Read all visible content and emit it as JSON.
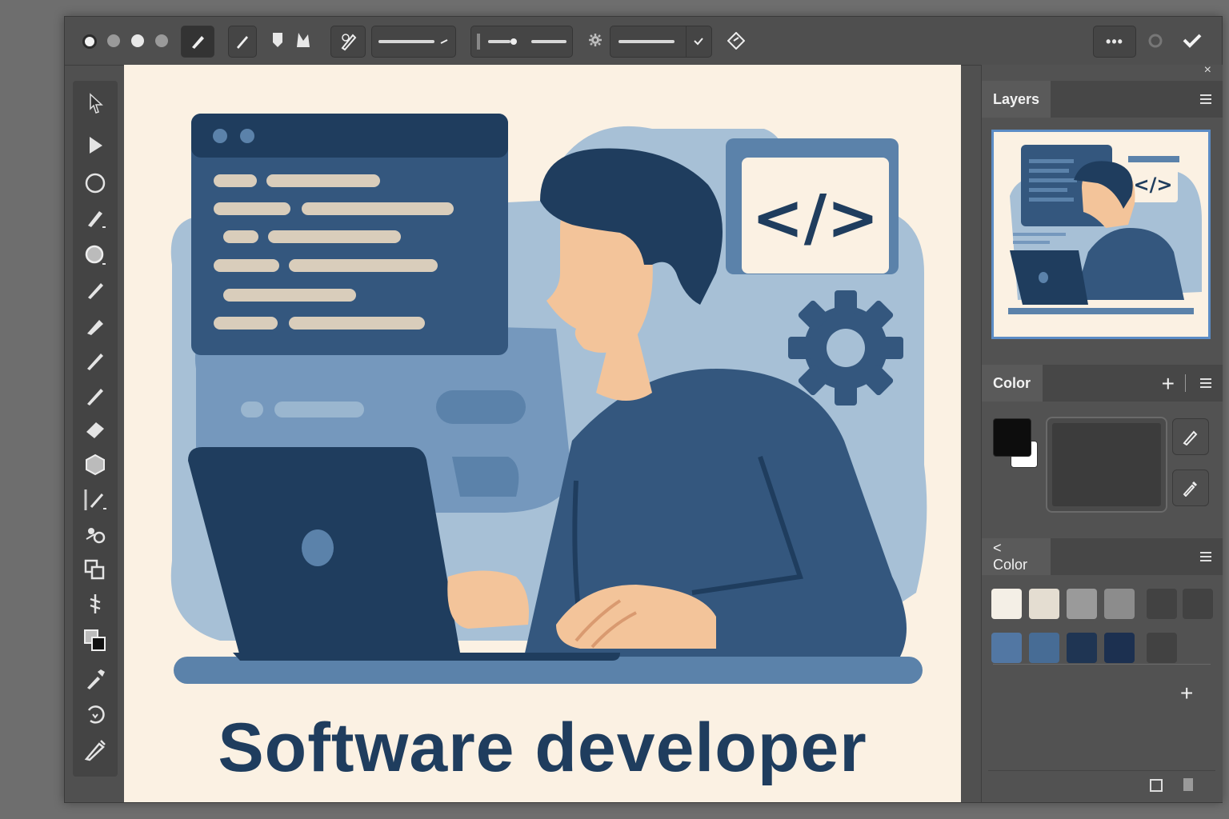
{
  "toolbar": {
    "icons": [
      "record-dot",
      "circle-dot",
      "circle-dot",
      "circle-dot",
      "pen-icon",
      "brush-icon",
      "shape-icons",
      "pencil-brush-icon",
      "stroke-dropdown",
      "slider",
      "gear-icon",
      "dropdown",
      "check-icon",
      "diamond-icon"
    ],
    "right": {
      "more_label": "•••",
      "status_icon": "circle-icon",
      "confirm_icon": "check-icon"
    }
  },
  "tools": [
    "select-arrow",
    "direct-select-arrow",
    "ellipse",
    "pen",
    "ellipse-tool",
    "brush",
    "blob-brush",
    "pencil",
    "line",
    "eraser",
    "polygon",
    "line-segment",
    "symbol-sprayer",
    "shape-builder",
    "width-tool",
    "fill-stroke",
    "eyedropper",
    "rotate",
    "knife"
  ],
  "artwork": {
    "title": "Software developer",
    "code_symbol": "</>",
    "colors": {
      "navy": "#1f3d5e",
      "blue": "#34577e",
      "light_blue": "#9ab6cf",
      "mid_blue": "#5b82aa",
      "bg": "#fbf1e3",
      "skin": "#f3c49a",
      "code_line": "#d9cdbb"
    }
  },
  "panels": {
    "layers": {
      "tab": "Layers"
    },
    "color": {
      "tab": "Color",
      "add": "+",
      "fill_color": "#0d0d0d",
      "stroke_color": "#ffffff",
      "preview_color": "#3c3c3c"
    },
    "swatches": {
      "tab": "< Color",
      "row1": [
        "#f4efe6",
        "#e4ddd1",
        "#9a9a9a",
        "#8c8c8c",
        "#424242",
        "#424242"
      ],
      "row2": [
        "#5277a3",
        "#476c95",
        "#1f3553",
        "#1c3050",
        "#424242"
      ],
      "add": "+"
    }
  },
  "close_label": "×"
}
